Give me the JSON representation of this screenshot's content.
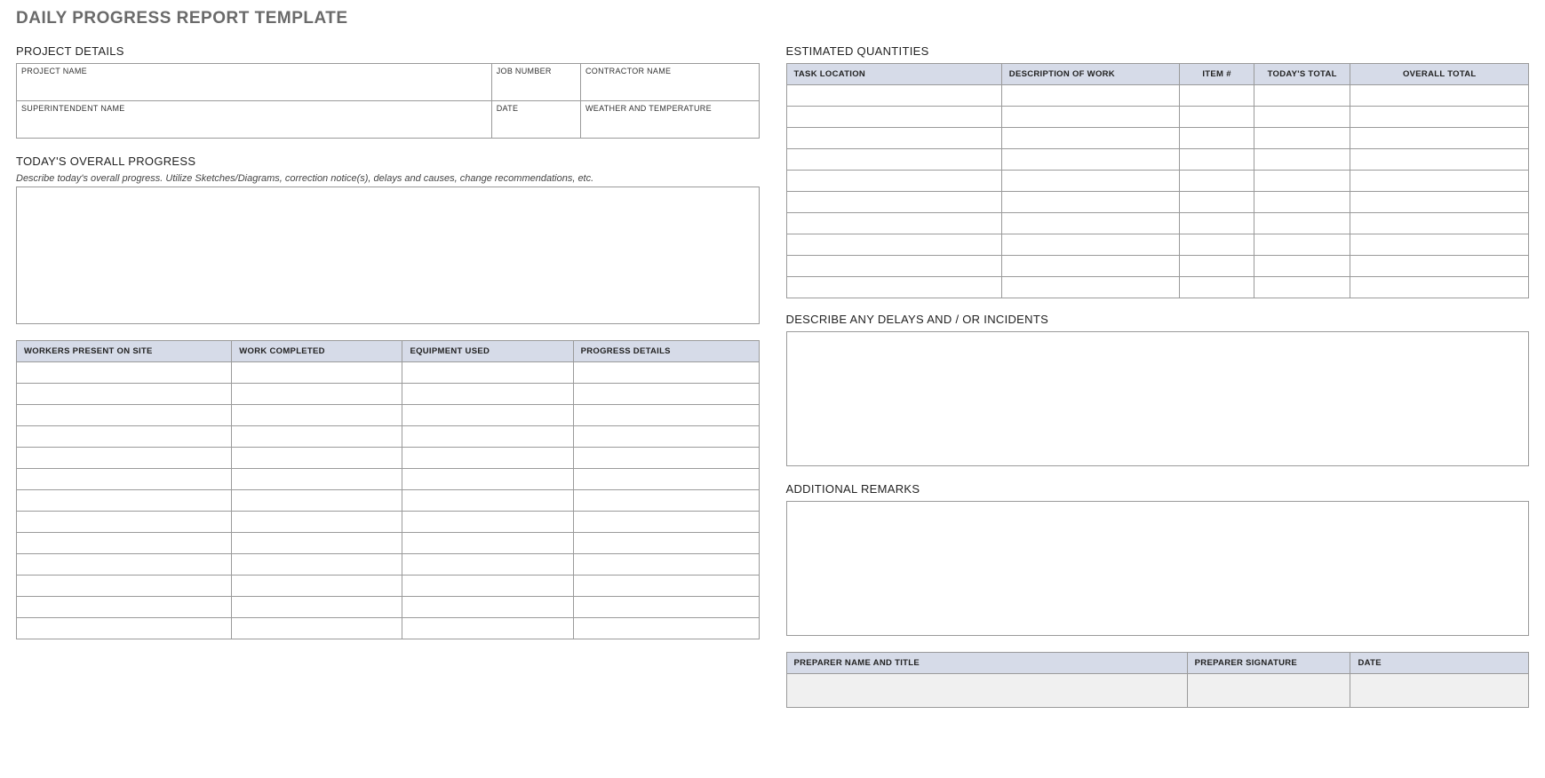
{
  "title": "DAILY PROGRESS REPORT TEMPLATE",
  "sections": {
    "project_details": "PROJECT DETAILS",
    "todays_progress": "TODAY'S OVERALL PROGRESS",
    "estimated_quantities": "ESTIMATED QUANTITIES",
    "delays": "DESCRIBE ANY DELAYS AND / OR INCIDENTS",
    "remarks": "ADDITIONAL REMARKS"
  },
  "project_details": {
    "labels": {
      "project_name": "PROJECT NAME",
      "job_number": "JOB NUMBER",
      "contractor_name": "CONTRACTOR NAME",
      "superintendent_name": "SUPERINTENDENT NAME",
      "date": "DATE",
      "weather": "WEATHER AND TEMPERATURE"
    },
    "values": {
      "project_name": "",
      "job_number": "",
      "contractor_name": "",
      "superintendent_name": "",
      "date": "",
      "weather": ""
    }
  },
  "progress": {
    "note": "Describe today's overall progress.  Utilize Sketches/Diagrams, correction notice(s), delays and causes, change recommendations, etc.",
    "text": "",
    "table_headers": {
      "workers": "WORKERS PRESENT ON SITE",
      "work_completed": "WORK COMPLETED",
      "equipment": "EQUIPMENT USED",
      "details": "PROGRESS DETAILS"
    },
    "rows": [
      {
        "workers": "",
        "work_completed": "",
        "equipment": "",
        "details": ""
      },
      {
        "workers": "",
        "work_completed": "",
        "equipment": "",
        "details": ""
      },
      {
        "workers": "",
        "work_completed": "",
        "equipment": "",
        "details": ""
      },
      {
        "workers": "",
        "work_completed": "",
        "equipment": "",
        "details": ""
      },
      {
        "workers": "",
        "work_completed": "",
        "equipment": "",
        "details": ""
      },
      {
        "workers": "",
        "work_completed": "",
        "equipment": "",
        "details": ""
      },
      {
        "workers": "",
        "work_completed": "",
        "equipment": "",
        "details": ""
      },
      {
        "workers": "",
        "work_completed": "",
        "equipment": "",
        "details": ""
      },
      {
        "workers": "",
        "work_completed": "",
        "equipment": "",
        "details": ""
      },
      {
        "workers": "",
        "work_completed": "",
        "equipment": "",
        "details": ""
      },
      {
        "workers": "",
        "work_completed": "",
        "equipment": "",
        "details": ""
      },
      {
        "workers": "",
        "work_completed": "",
        "equipment": "",
        "details": ""
      },
      {
        "workers": "",
        "work_completed": "",
        "equipment": "",
        "details": ""
      }
    ]
  },
  "quantities": {
    "headers": {
      "task_location": "TASK LOCATION",
      "description": "DESCRIPTION OF WORK",
      "item_no": "ITEM #",
      "todays_total": "TODAY'S TOTAL",
      "overall_total": "OVERALL TOTAL"
    },
    "rows": [
      {
        "task_location": "",
        "description": "",
        "item_no": "",
        "todays_total": "",
        "overall_total": ""
      },
      {
        "task_location": "",
        "description": "",
        "item_no": "",
        "todays_total": "",
        "overall_total": ""
      },
      {
        "task_location": "",
        "description": "",
        "item_no": "",
        "todays_total": "",
        "overall_total": ""
      },
      {
        "task_location": "",
        "description": "",
        "item_no": "",
        "todays_total": "",
        "overall_total": ""
      },
      {
        "task_location": "",
        "description": "",
        "item_no": "",
        "todays_total": "",
        "overall_total": ""
      },
      {
        "task_location": "",
        "description": "",
        "item_no": "",
        "todays_total": "",
        "overall_total": ""
      },
      {
        "task_location": "",
        "description": "",
        "item_no": "",
        "todays_total": "",
        "overall_total": ""
      },
      {
        "task_location": "",
        "description": "",
        "item_no": "",
        "todays_total": "",
        "overall_total": ""
      },
      {
        "task_location": "",
        "description": "",
        "item_no": "",
        "todays_total": "",
        "overall_total": ""
      },
      {
        "task_location": "",
        "description": "",
        "item_no": "",
        "todays_total": "",
        "overall_total": ""
      }
    ]
  },
  "delays": {
    "text": ""
  },
  "remarks": {
    "text": ""
  },
  "signature": {
    "headers": {
      "preparer": "PREPARER NAME AND TITLE",
      "signature": "PREPARER SIGNATURE",
      "date": "DATE"
    },
    "values": {
      "preparer": "",
      "signature": "",
      "date": ""
    }
  }
}
